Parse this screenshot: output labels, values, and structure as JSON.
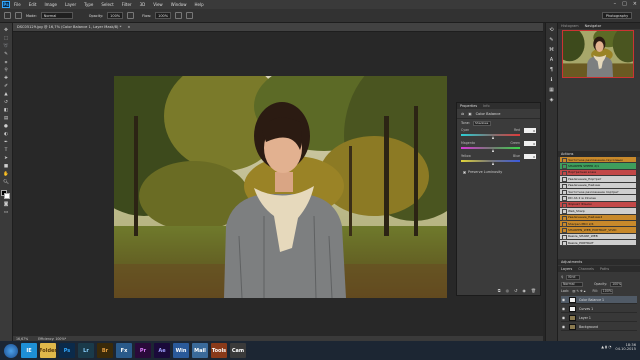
{
  "app": {
    "logo": "Ps"
  },
  "menubar": {
    "items": [
      "File",
      "Edit",
      "Image",
      "Layer",
      "Type",
      "Select",
      "Filter",
      "3D",
      "View",
      "Window",
      "Help"
    ],
    "window_controls": [
      "–",
      "□",
      "×"
    ]
  },
  "options_bar": {
    "mode_label": "Mode:",
    "mode_value": "Normal",
    "opacity_label": "Opacity:",
    "opacity_value": "100%",
    "flow_label": "Flow:",
    "flow_value": "100%",
    "workspace": "Photography"
  },
  "document": {
    "tab_title": "DSC05129.jpg @ 16,7% (Color Balance 1, Layer Mask/8) *",
    "zoom": "16,67%",
    "info": "Efficiency: 100%*"
  },
  "properties_panel": {
    "tabs": [
      "Properties",
      "Info"
    ],
    "title": "Color Balance",
    "tone_label": "Tone:",
    "tone_value": "Shadows",
    "sliders": [
      {
        "left": "Cyan",
        "right": "Red",
        "value": "0"
      },
      {
        "left": "Magenta",
        "right": "Green",
        "value": "0"
      },
      {
        "left": "Yellow",
        "right": "Blue",
        "value": "0"
      }
    ],
    "preserve_label": "Preserve Luminosity"
  },
  "right_panels": {
    "top_tabs": [
      "Histogram",
      "Navigator"
    ],
    "actions_title": "Actions",
    "actions": [
      {
        "label": "Частотное разложение-гауссовым",
        "color": "#c8892b"
      },
      {
        "label": "SHARPEN SHEER 2/1",
        "color": "#3e9e5d"
      },
      {
        "label": "Портретная кожа",
        "color": "#c24848"
      },
      {
        "label": "Увеличение_Портрет",
        "color": "#cfcfcf"
      },
      {
        "label": "Увеличение_Пейзаж",
        "color": "#cfcfcf"
      },
      {
        "label": "Частотное разложение портрет",
        "color": "#cfcfcf"
      },
      {
        "label": "DD AS 2 w Intuose",
        "color": "#cfcfcf"
      },
      {
        "label": "Формат Фоном",
        "color": "#c24848"
      },
      {
        "label": "Web_Sharp",
        "color": "#cfcfcf"
      },
      {
        "label": "Увеличение_Пейзаж2",
        "color": "#c8892b"
      },
      {
        "label": "Sharpen PRO 2/4",
        "color": "#c8892b"
      },
      {
        "label": "SHARPEN_WEB_PORTRAIT_VIVID",
        "color": "#c8892b"
      },
      {
        "label": "Resize_SHARP_WEB",
        "color": "#cfcfcf"
      },
      {
        "label": "Resize_PORTRAIT",
        "color": "#cfcfcf"
      }
    ],
    "adjustments_title": "Adjustments",
    "layers_tabs": [
      "Layers",
      "Channels",
      "Paths"
    ],
    "kind_label": "Kind",
    "blend_mode": "Normal",
    "opacity_label": "Opacity:",
    "opacity_value": "100%",
    "lock_label": "Lock:",
    "fill_label": "Fill:",
    "fill_value": "100%",
    "layers": [
      {
        "name": "Color Balance 1",
        "selected": true
      },
      {
        "name": "Curves 1",
        "selected": false
      },
      {
        "name": "Layer 1",
        "selected": false
      },
      {
        "name": "Background",
        "selected": false
      }
    ]
  },
  "taskbar": {
    "apps": [
      "IE",
      "Folder",
      "Ps",
      "Lr",
      "Br",
      "Fx",
      "Pr",
      "Ae",
      "Win",
      "Mail",
      "Tools",
      "Cam"
    ],
    "time": "18:36",
    "date": "04.10.2015"
  }
}
